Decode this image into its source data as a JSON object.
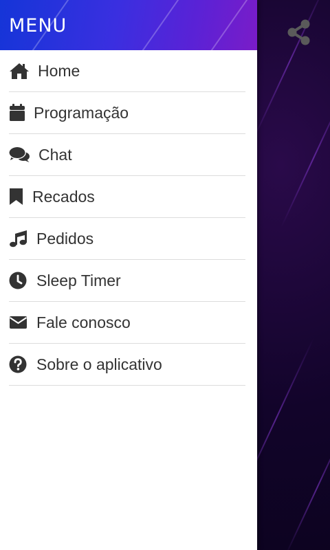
{
  "drawer": {
    "title": "MENU",
    "items": [
      {
        "label": "Home",
        "icon": "home-icon"
      },
      {
        "label": "Programação",
        "icon": "calendar-icon"
      },
      {
        "label": "Chat",
        "icon": "chat-bubbles-icon"
      },
      {
        "label": "Recados",
        "icon": "bookmark-icon"
      },
      {
        "label": "Pedidos",
        "icon": "music-note-icon"
      },
      {
        "label": "Sleep Timer",
        "icon": "clock-icon"
      },
      {
        "label": "Fale conosco",
        "icon": "envelope-icon"
      },
      {
        "label": "Sobre o aplicativo",
        "icon": "question-circle-icon"
      }
    ]
  },
  "toolbar": {
    "share_icon": "share-icon"
  },
  "colors": {
    "header_start": "#1535d8",
    "header_end": "#7a1cc8",
    "menu_text": "#333333",
    "icon": "#333333",
    "divider": "#dcdcdc",
    "background": "#12042a"
  }
}
